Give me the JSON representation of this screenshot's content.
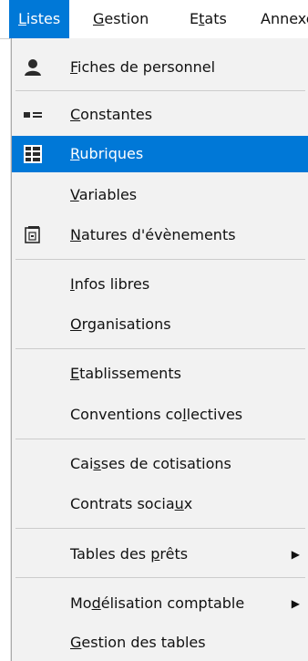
{
  "menubar": {
    "items": [
      {
        "label_underlined": "L",
        "label_rest": "istes"
      },
      {
        "label_underlined": "G",
        "label_rest": "estion"
      },
      {
        "label_prefix": "E",
        "label_underlined": "t",
        "label_rest": "ats"
      },
      {
        "label": "Annexes"
      }
    ]
  },
  "menu": {
    "items": [
      {
        "pre": "",
        "u": "F",
        "post": "iches de personnel",
        "icon": "person-icon"
      },
      {
        "pre": "",
        "u": "C",
        "post": "onstantes",
        "icon": "constants-icon"
      },
      {
        "pre": "",
        "u": "R",
        "post": "ubriques",
        "icon": "list-icon",
        "selected": true
      },
      {
        "pre": "",
        "u": "V",
        "post": "ariables"
      },
      {
        "pre": "",
        "u": "N",
        "post": "atures d'évènements",
        "icon": "calendar-icon"
      },
      {
        "pre": "",
        "u": "I",
        "post": "nfos libres"
      },
      {
        "pre": "",
        "u": "O",
        "post": "rganisations"
      },
      {
        "pre": "",
        "u": "E",
        "post": "tablissements"
      },
      {
        "pre": "Conventions co",
        "u": "l",
        "post": "lectives"
      },
      {
        "pre": "Cai",
        "u": "s",
        "post": "ses de cotisations"
      },
      {
        "pre": "Contrats socia",
        "u": "u",
        "post": "x"
      },
      {
        "pre": "Tables des ",
        "u": "p",
        "post": "rêts",
        "submenu": true
      },
      {
        "pre": "Mo",
        "u": "d",
        "post": "élisation comptable",
        "submenu": true
      },
      {
        "pre": "",
        "u": "G",
        "post": "estion des tables"
      }
    ]
  },
  "colors": {
    "accent": "#0078d7",
    "menu_bg": "#f2f2f2"
  }
}
